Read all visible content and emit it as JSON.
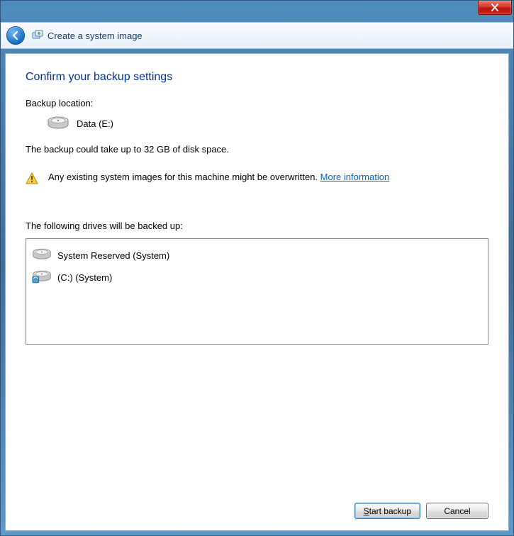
{
  "titlebar": {},
  "nav": {
    "breadcrumb": "Create a system image"
  },
  "page": {
    "heading": "Confirm your backup settings",
    "backup_location_label": "Backup location:",
    "backup_location_value": "Data (E:)",
    "size_note": "The backup could take up to 32 GB of disk space.",
    "warning_text": "Any existing system images for this machine might be overwritten. ",
    "more_info_link": "More information",
    "drives_label": "The following drives will be backed up:",
    "drives": [
      {
        "label": "System Reserved (System)",
        "icon": "drive"
      },
      {
        "label": "(C:) (System)",
        "icon": "drive-windows"
      }
    ]
  },
  "footer": {
    "start_mnemonic": "S",
    "start_rest": "tart backup",
    "cancel": "Cancel"
  }
}
